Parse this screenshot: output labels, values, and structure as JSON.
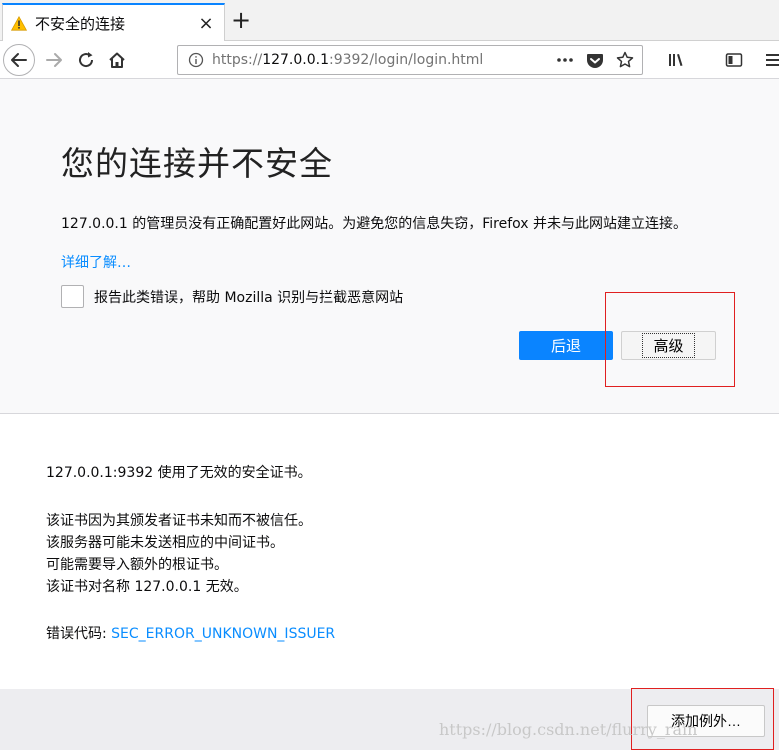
{
  "tab": {
    "title": "不安全的连接",
    "close": "×"
  },
  "new_tab": "+",
  "url": {
    "prefix": "https://",
    "host": "127.0.0.1",
    "rest": ":9392/login/login.html"
  },
  "page": {
    "title": "您的连接并不安全",
    "intro": "127.0.0.1 的管理员没有正确配置好此网站。为避免您的信息失窃，Firefox 并未与此网站建立连接。",
    "learn_more": "详细了解…",
    "report_label": "报告此类错误，帮助 Mozilla 识别与拦截恶意网站",
    "back_button": "后退",
    "advanced_button": "高级"
  },
  "advanced": {
    "line1": "127.0.0.1:9392 使用了无效的安全证书。",
    "line2": "该证书因为其颁发者证书未知而不被信任。",
    "line3": "该服务器可能未发送相应的中间证书。",
    "line4": "可能需要导入额外的根证书。",
    "line5": "该证书对名称 127.0.0.1 无效。",
    "error_label": "错误代码:",
    "error_code": "SEC_ERROR_UNKNOWN_ISSUER",
    "add_exception": "添加例外…"
  },
  "watermark": "https://blog.csdn.net/flurry_rain",
  "colors": {
    "accent": "#0a84ff",
    "link": "#0a8dff",
    "highlight_box": "#e02020"
  },
  "icons": [
    "warning-icon",
    "close-icon",
    "plus-icon",
    "back-arrow-icon",
    "forward-arrow-icon",
    "reload-icon",
    "home-icon",
    "info-icon",
    "more-icon",
    "pocket-icon",
    "star-icon",
    "library-icon",
    "sidebar-icon",
    "menu-icon"
  ]
}
